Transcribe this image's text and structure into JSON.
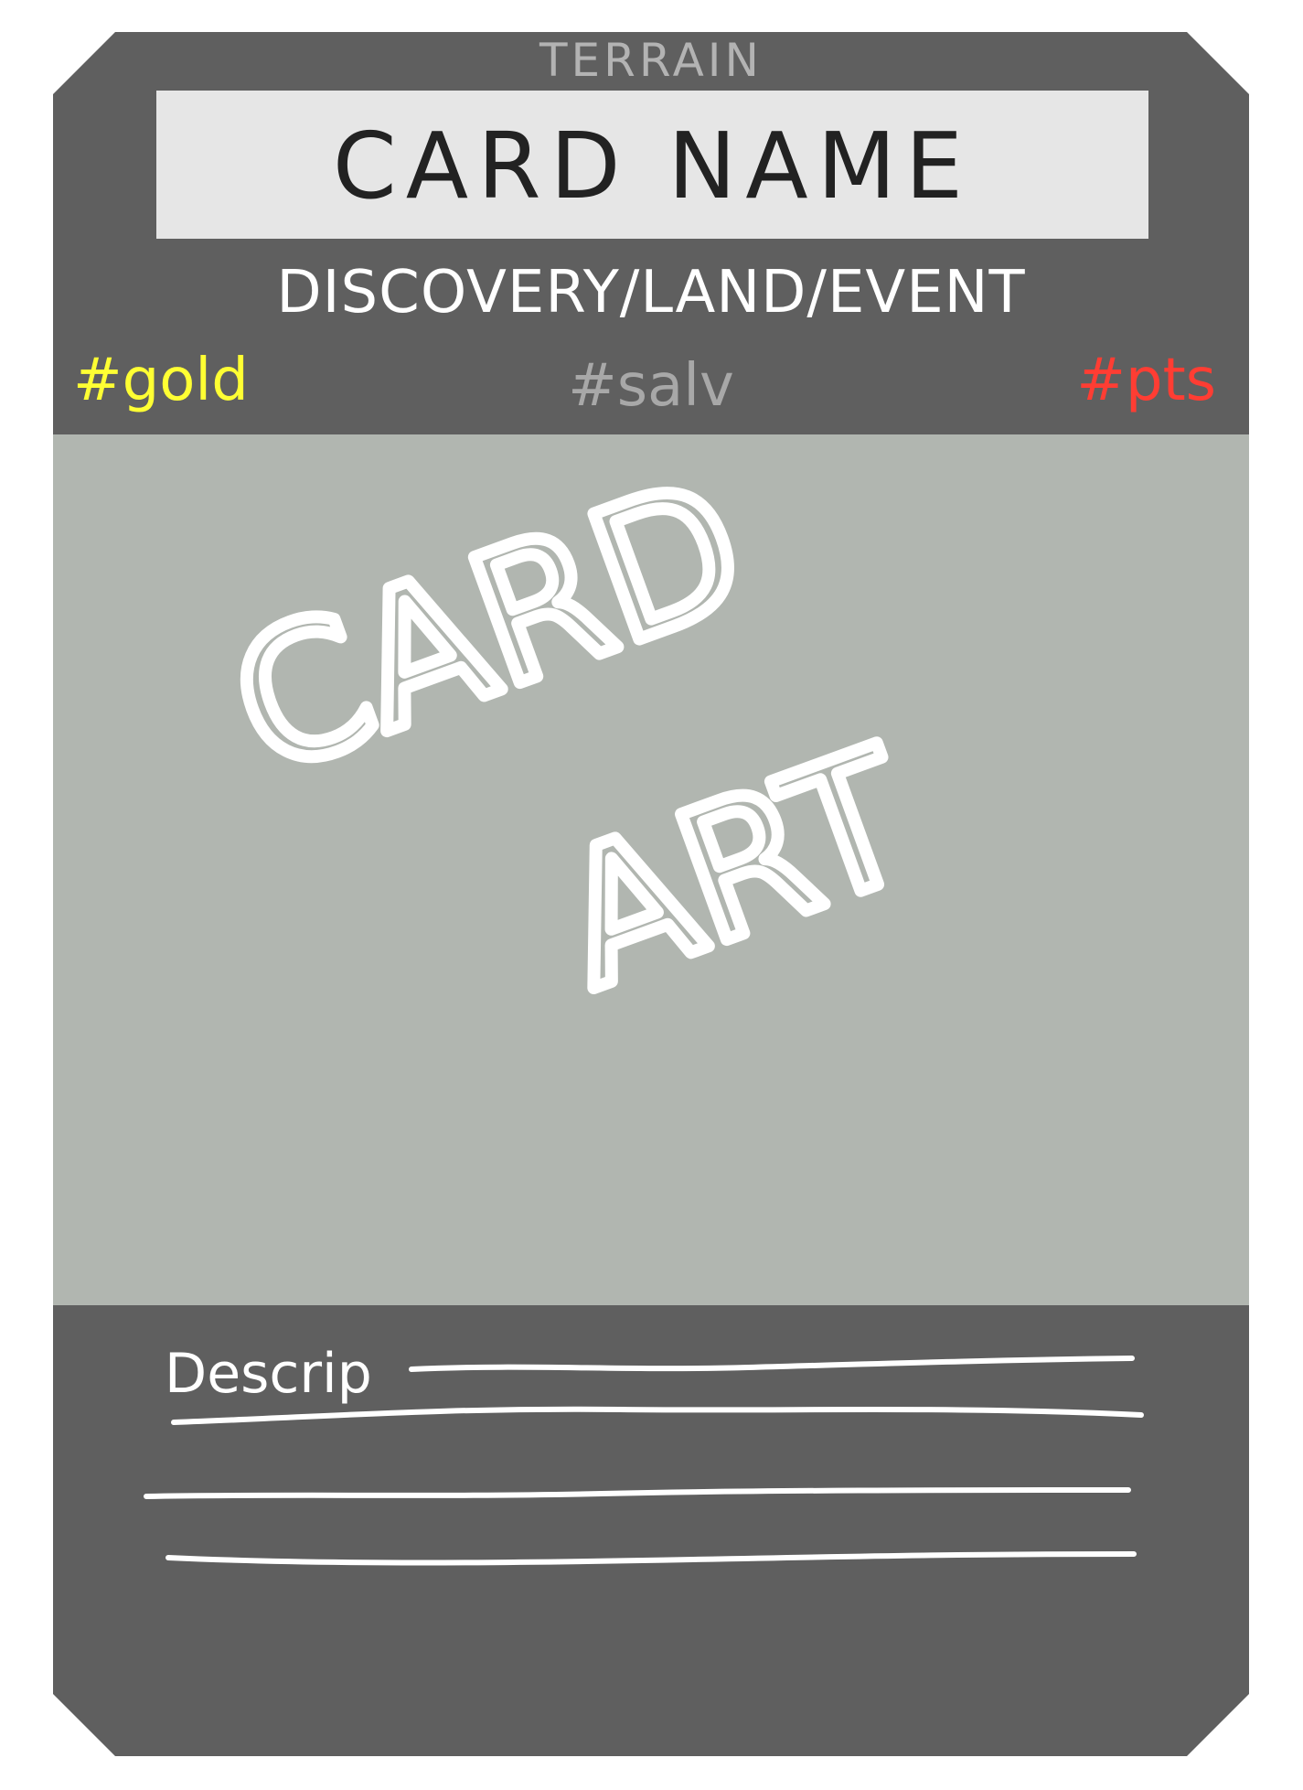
{
  "card": {
    "terrain": "TERRAIN",
    "name": "CARD NAME",
    "type": "DISCOVERY/LAND/EVENT",
    "gold": "#gold",
    "salvage": "#salv",
    "points": "#pts",
    "art_label_line1": "CARD",
    "art_label_line2": "ART",
    "description_label": "Descrip"
  },
  "colors": {
    "frame": "#5f5f5f",
    "name_box": "#e6e6e6",
    "art_area": "#b1b6b0",
    "gold": "#ffff33",
    "salvage": "#a8a8a8",
    "points": "#ff3d33",
    "terrain_text": "#b3b3b3"
  }
}
